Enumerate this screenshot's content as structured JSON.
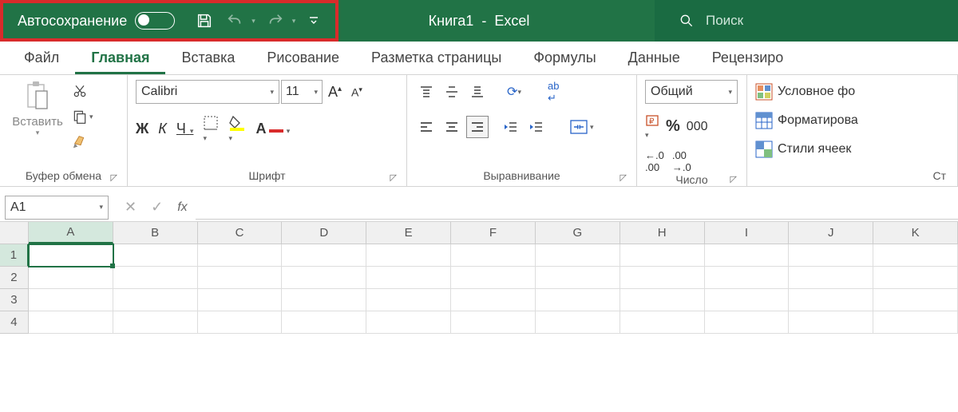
{
  "titlebar": {
    "autosave_label": "Автосохранение",
    "doc_name": "Книга1",
    "app_name": "Excel",
    "search_placeholder": "Поиск"
  },
  "tabs": {
    "file": "Файл",
    "home": "Главная",
    "insert": "Вставка",
    "draw": "Рисование",
    "layout": "Разметка страницы",
    "formulas": "Формулы",
    "data": "Данные",
    "review": "Рецензиро"
  },
  "ribbon": {
    "clipboard": {
      "paste": "Вставить",
      "label": "Буфер обмена"
    },
    "font": {
      "name": "Calibri",
      "size": "11",
      "bold": "Ж",
      "italic": "К",
      "underline": "Ч",
      "label": "Шрифт"
    },
    "alignment": {
      "wrap": "ab",
      "label": "Выравнивание"
    },
    "number": {
      "format": "Общий",
      "label": "Число"
    },
    "styles": {
      "cond": "Условное фо",
      "table": "Форматирова",
      "cell": "Стили ячеек",
      "label": "Ст"
    }
  },
  "namebox": {
    "ref": "A1",
    "fx": "fx"
  },
  "grid": {
    "cols": [
      "A",
      "B",
      "C",
      "D",
      "E",
      "F",
      "G",
      "H",
      "I",
      "J",
      "K"
    ],
    "rows": [
      "1",
      "2",
      "3",
      "4"
    ]
  },
  "colors": {
    "excel_green": "#217346",
    "highlight_red": "#d92b2b"
  }
}
